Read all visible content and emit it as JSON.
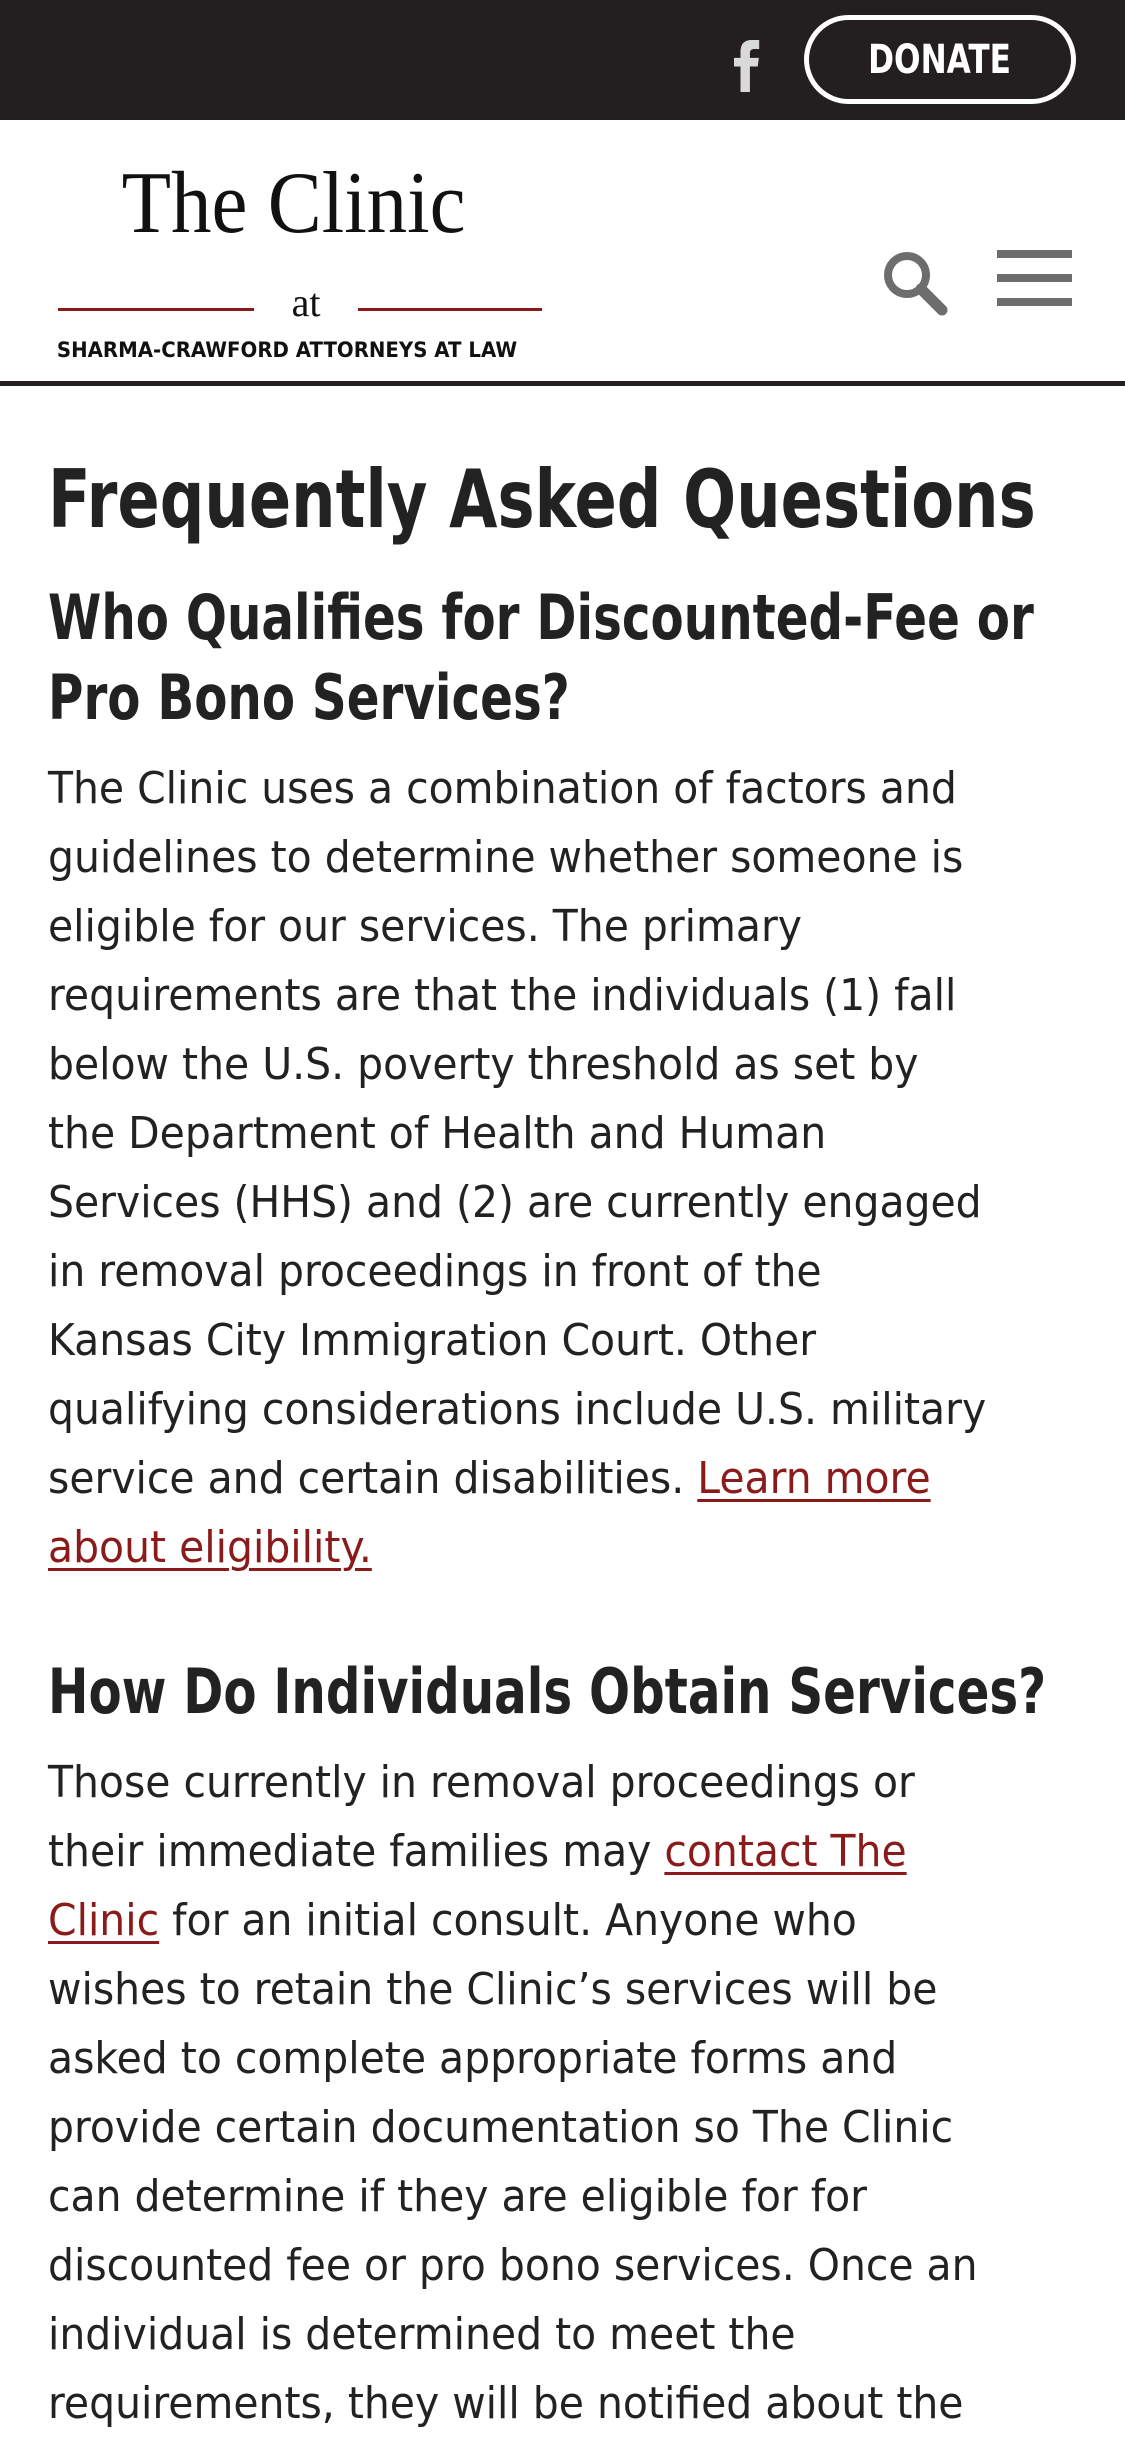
{
  "topbar": {
    "donate_label": "DONATE"
  },
  "logo": {
    "title": "The Clinic",
    "at": "at",
    "subtitle": "SHARMA-CRAWFORD ATTORNEYS AT LAW"
  },
  "page_title": "Frequently Asked Questions",
  "sections": [
    {
      "heading_lines": [
        "Who Qualifies for Discounted-Fee or",
        "Pro Bono Services?"
      ],
      "body_lines": [
        "The Clinic uses a combination of factors and",
        "guidelines to determine whether someone is",
        "eligible for our services. The primary",
        "requirements are that the individuals (1) fall",
        "below the U.S. poverty threshold as set by",
        "the Department of Health and Human",
        "Services (HHS) and (2) are currently engaged",
        "in removal proceedings in front of the",
        "Kansas City Immigration Court. Other",
        "qualifying considerations include U.S. military",
        "service and certain disabilities. "
      ],
      "link_part1": "Learn more",
      "link_part2": "about eligibility."
    },
    {
      "heading": "How Do Individuals Obtain Services?",
      "line1": "Those currently in removal proceedings or",
      "line2_prefix": "their immediate families may ",
      "link_part1": "contact The",
      "link_part2": "Clinic",
      "line3_suffix": " for an initial consult. Anyone who",
      "body_lines": [
        "wishes to retain the Clinic’s services will be",
        "asked to complete appropriate forms and",
        "provide certain documentation so The Clinic",
        "can determine if they are eligible for  for",
        "discounted fee or pro bono services. Once an",
        "individual is determined to meet the",
        "requirements, they will be notified about the"
      ]
    }
  ],
  "icons": {
    "facebook": "facebook-icon",
    "search": "search-icon",
    "menu": "hamburger-menu-icon"
  },
  "colors": {
    "topbar": "#231f20",
    "link": "#8b1a1a",
    "text": "#222222"
  }
}
